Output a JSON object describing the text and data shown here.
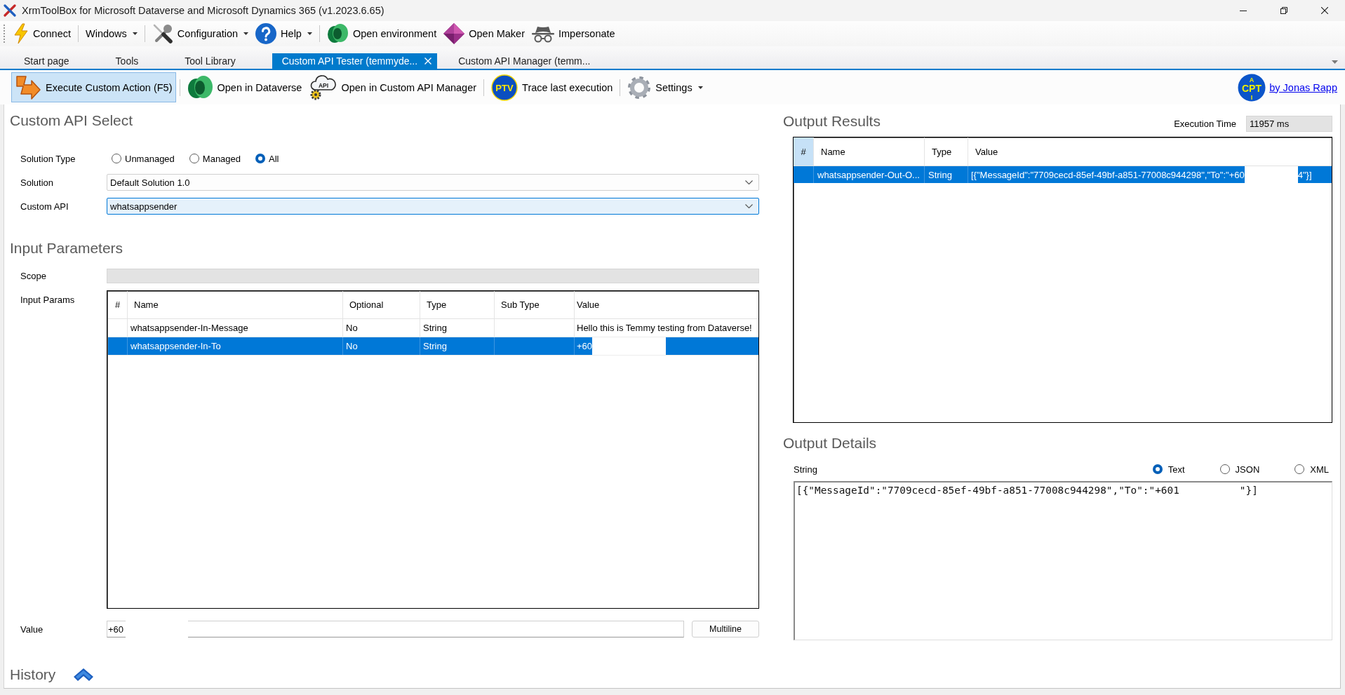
{
  "window": {
    "title": "XrmToolBox for Microsoft Dataverse and Microsoft Dynamics 365 (v1.2023.6.65)"
  },
  "main_toolbar": {
    "groups": [
      [
        {
          "label": "Connect",
          "kind": "button"
        }
      ],
      [
        {
          "label": "Windows",
          "kind": "menu"
        }
      ],
      [
        {
          "label": "Configuration",
          "kind": "menu"
        },
        {
          "label": "Help",
          "kind": "menu"
        }
      ],
      [
        {
          "label": "Open environment",
          "kind": "button"
        },
        {
          "label": "Open Maker",
          "kind": "button"
        },
        {
          "label": "Impersonate",
          "kind": "button"
        }
      ]
    ]
  },
  "tabs": [
    {
      "label": "Start page",
      "selected": false
    },
    {
      "label": "Tools",
      "selected": false
    },
    {
      "label": "Tool Library",
      "selected": false
    },
    {
      "label": "Custom API Tester (temmyde...",
      "selected": true
    },
    {
      "label": "Custom API Manager (temm...",
      "selected": false
    }
  ],
  "tool_toolbar": {
    "groups": [
      [
        {
          "label": "Execute Custom Action (F5)",
          "kind": "button",
          "highlighted": true
        }
      ],
      [
        {
          "label": "Open in Dataverse",
          "kind": "button",
          "highlighted": false
        },
        {
          "label": "Open in Custom API Manager",
          "kind": "button",
          "highlighted": false,
          "logo_text": "API"
        }
      ],
      [
        {
          "label": "Trace last execution",
          "kind": "button",
          "highlighted": false,
          "logo_text": "PTV"
        }
      ],
      [
        {
          "label": "Settings",
          "kind": "menu",
          "highlighted": false
        }
      ]
    ],
    "author": {
      "logo_lines": [
        "A",
        "CPT",
        "I"
      ],
      "link": "by Jonas Rapp"
    }
  },
  "custom_api_select": {
    "title": "Custom API Select",
    "solution_type": {
      "label": "Solution Type",
      "options": [
        {
          "label": "Unmanaged",
          "selected": false
        },
        {
          "label": "Managed",
          "selected": false
        },
        {
          "label": "All",
          "selected": true
        }
      ]
    },
    "solution": {
      "label": "Solution",
      "value": "Default Solution 1.0",
      "focused": false
    },
    "custom_api": {
      "label": "Custom API",
      "value": "whatsappsender",
      "focused": true
    }
  },
  "input_parameters": {
    "title": "Input Parameters",
    "scope": {
      "label": "Scope",
      "disabled": true
    },
    "params": {
      "label": "Input Params",
      "columns": [
        "#",
        "Name",
        "Optional",
        "Type",
        "Sub Type",
        "Value"
      ],
      "rows": [
        {
          "name": "whatsappsender-In-Message",
          "optional": "No",
          "type": "String",
          "value": "Hello this is Temmy testing from Dataverse!",
          "redacted": false,
          "selected": false
        },
        {
          "name": "whatsappsender-In-To",
          "optional": "No",
          "type": "String",
          "value": "+60",
          "redacted": true,
          "selected": true
        }
      ]
    },
    "value": {
      "label": "Value",
      "value": "+60",
      "redacted": true,
      "button": "Multiline"
    }
  },
  "history": {
    "title": "History",
    "expanded": false
  },
  "output_results": {
    "title": "Output Results",
    "execution_time": {
      "label": "Execution Time",
      "value": "11957 ms"
    },
    "columns": [
      {
        "label": "#",
        "highlighted": true
      },
      {
        "label": "Name",
        "highlighted": false
      },
      {
        "label": "Type",
        "highlighted": false
      },
      {
        "label": "Value",
        "highlighted": false
      }
    ],
    "rows": [
      {
        "name": "whatsappsender-Out-O...",
        "type": "String",
        "value": "[{\"MessageId\":\"7709cecd-85ef-49bf-a851-77008c944298\",\"To\":\"+60",
        "redacted": true,
        "value_end": "4\"}]",
        "selected": true
      }
    ]
  },
  "output_details": {
    "title": "Output Details",
    "type_label": "String",
    "formats": [
      {
        "label": "Text",
        "selected": true
      },
      {
        "label": "JSON",
        "selected": false
      },
      {
        "label": "XML",
        "selected": false
      }
    ],
    "text": "[{\"MessageId\":\"7709cecd-85ef-49bf-a851-77008c944298\",\"To\":\"+601",
    "redacted": true,
    "text_end": "\"}]"
  }
}
